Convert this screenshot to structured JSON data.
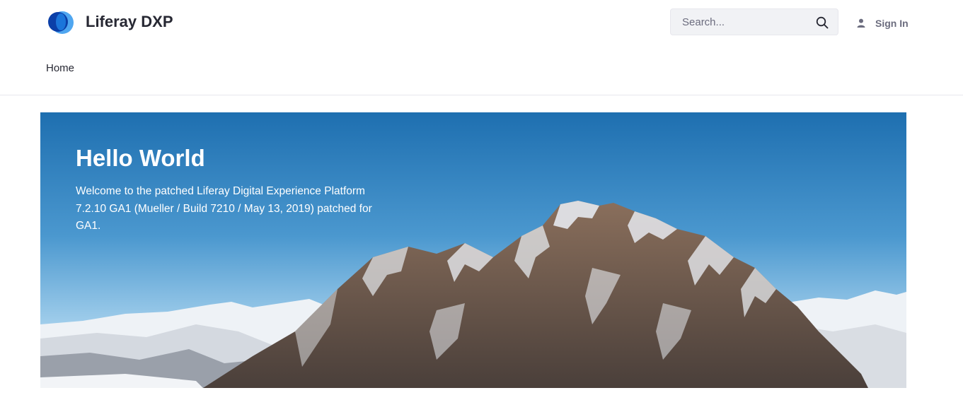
{
  "header": {
    "brand": "Liferay DXP",
    "search": {
      "placeholder": "Search..."
    },
    "sign_in_label": "Sign In"
  },
  "nav": {
    "items": [
      {
        "label": "Home"
      }
    ]
  },
  "hero": {
    "title": "Hello World",
    "text": "Welcome to the patched Liferay Digital Experience Platform 7.2.10 GA1 (Mueller / Build 7210 / May 13, 2019) patched for GA1."
  },
  "colors": {
    "brand_dark": "#0b5fff",
    "brand_light": "#1e90ff",
    "sky_top": "#1e6fb0",
    "sky_bottom": "#a9d3ee"
  },
  "icons": {
    "logo": "liferay-logo",
    "search": "search-icon",
    "user": "user-icon"
  }
}
